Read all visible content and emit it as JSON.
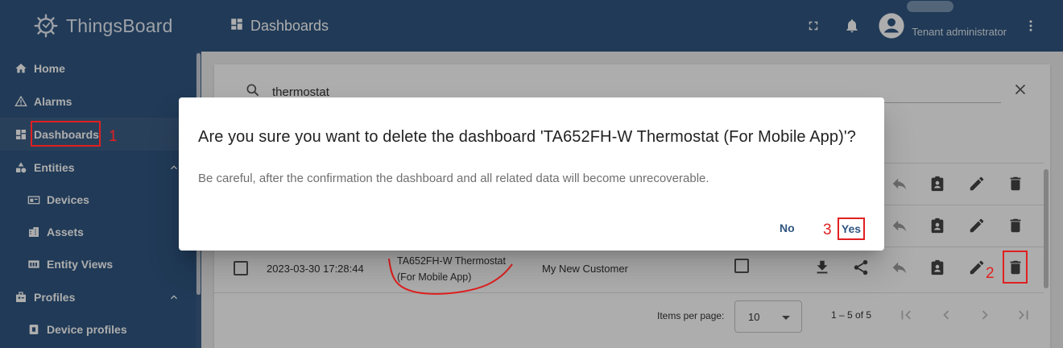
{
  "app": {
    "name": "ThingsBoard"
  },
  "header": {
    "title": "Dashboards",
    "user_role": "Tenant administrator"
  },
  "sidebar": {
    "items": [
      {
        "label": "Home",
        "icon": "home-icon"
      },
      {
        "label": "Alarms",
        "icon": "warning-icon"
      },
      {
        "label": "Dashboards",
        "icon": "dashboard-icon",
        "active": true
      },
      {
        "label": "Entities",
        "icon": "entities-icon",
        "expanded": true
      },
      {
        "label": "Devices",
        "icon": "devices-icon"
      },
      {
        "label": "Assets",
        "icon": "assets-icon"
      },
      {
        "label": "Entity Views",
        "icon": "entity-views-icon"
      },
      {
        "label": "Profiles",
        "icon": "profiles-icon",
        "expanded": true
      },
      {
        "label": "Device profiles",
        "icon": "device-profile-icon"
      }
    ]
  },
  "search": {
    "value": "thermostat"
  },
  "table": {
    "visible_row": {
      "created": "2023-03-30 17:28:44",
      "title_line1": "TA652FH-W Thermostat",
      "title_line2": "(For Mobile App)",
      "customer": "My New Customer"
    }
  },
  "paginator": {
    "items_per_page_label": "Items per page:",
    "page_size": "10",
    "range": "1 – 5 of 5"
  },
  "dialog": {
    "title": "Are you sure you want to delete the dashboard 'TA652FH-W Thermostat (For Mobile App)'?",
    "message": "Be careful, after the confirmation the dashboard and all related data will become unrecoverable.",
    "no_label": "No",
    "yes_label": "Yes"
  },
  "annotations": {
    "step1": "1",
    "step2": "2",
    "step3": "3"
  },
  "colors": {
    "primary": "#305680",
    "annotation": "#e02020"
  }
}
